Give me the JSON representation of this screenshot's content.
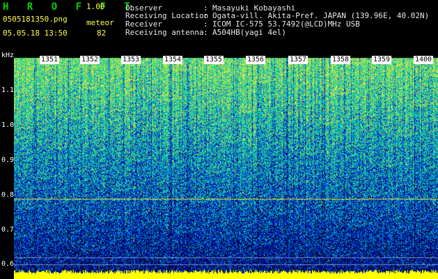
{
  "app": {
    "name": "H R O F F T",
    "version": "1.00",
    "filename": "0505181350.png",
    "mode": "meteor",
    "count": "82",
    "datetime": "05.05.18 13:50"
  },
  "info": {
    "labels": [
      "Observer",
      "Receiving Location",
      "Receiver",
      "Receiving antenna"
    ],
    "separator": ":",
    "values": [
      "Masayuki Kobayashi",
      "Ogata-vill. Akita-Pref. JAPAN (139.96E, 40.02N)",
      "ICOM IC-575 53.7492(@LCD)MHz USB",
      "A504HB(yagi 4el)"
    ]
  },
  "spectrogram": {
    "y_unit": "kHz",
    "y_ticks": [
      "1.1",
      "1.0",
      "0.9",
      "0.8",
      "0.7",
      "0.6"
    ],
    "time_ticks": [
      "1351",
      "1352",
      "1353",
      "1354",
      "1355",
      "1356",
      "1357",
      "1358",
      "1359",
      "1400"
    ]
  }
}
